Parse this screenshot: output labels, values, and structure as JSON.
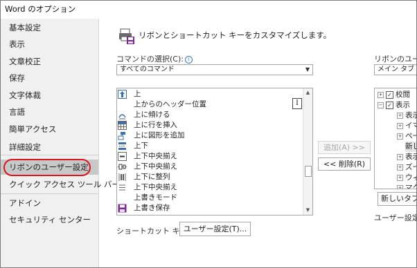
{
  "window": {
    "title": "Word のオプション"
  },
  "nav": {
    "items": [
      {
        "label": "基本設定"
      },
      {
        "label": "表示"
      },
      {
        "label": "文章校正"
      },
      {
        "label": "保存"
      },
      {
        "label": "文字体裁"
      },
      {
        "label": "言語"
      },
      {
        "label": "簡単アクセス"
      },
      {
        "label": "詳細設定"
      },
      {
        "label": "リボンのユーザー設定"
      },
      {
        "label": "クイック アクセス ツール バー"
      },
      {
        "label": "アドイン"
      },
      {
        "label": "セキュリティ センター"
      }
    ],
    "selected_index": 8,
    "highlight_color": "#d8141c"
  },
  "main": {
    "header": "リボンとショートカット キーをカスタマイズします。",
    "command_select_label": "コマンドの選択(C):",
    "command_select_value": "すべてのコマンド",
    "ribbon_label": "リボンのユーザ",
    "ribbon_value": "メイン タブ",
    "commands": [
      {
        "label": "上",
        "icon": "arrow-up-icon"
      },
      {
        "label": "上からのヘッダー位置",
        "icon": "none"
      },
      {
        "label": "上に傾ける",
        "icon": "tilt-up-icon"
      },
      {
        "label": "上に行を挿入",
        "icon": "insert-row-above-icon"
      },
      {
        "label": "上に図形を追加",
        "icon": "add-shape-above-icon"
      },
      {
        "label": "上下",
        "icon": "top-bottom-icon"
      },
      {
        "label": "上下中央揃え",
        "icon": "align-middle-icon"
      },
      {
        "label": "上下中央揃え",
        "icon": "align-middle-v-icon"
      },
      {
        "label": "上下に整列",
        "icon": "distribute-vertical-icon"
      },
      {
        "label": "上下中央揃え",
        "icon": "none"
      },
      {
        "label": "上書きモード",
        "icon": "none"
      },
      {
        "label": "上書き保存",
        "icon": "save-icon"
      }
    ],
    "add_button": "追加(A) >>",
    "remove_button": "<< 削除(R)",
    "tree": [
      {
        "label": "校閲",
        "level": 0,
        "expander": "⊞",
        "checked": true
      },
      {
        "label": "表示",
        "level": 0,
        "expander": "⊟",
        "checked": true
      },
      {
        "label": "表示",
        "level": 1,
        "expander": "⊞"
      },
      {
        "label": "イマ",
        "level": 1,
        "expander": "⊞"
      },
      {
        "label": "ペー",
        "level": 1,
        "expander": "⊞"
      },
      {
        "label": "新し",
        "level": 1,
        "expander": ""
      },
      {
        "label": "表示",
        "level": 1,
        "expander": "⊞"
      },
      {
        "label": "ズー",
        "level": 1,
        "expander": "⊞"
      },
      {
        "label": "ウィ",
        "level": 1,
        "expander": "⊞"
      },
      {
        "label": "マク",
        "level": 1,
        "expander": "⊞"
      }
    ],
    "new_tab_button": "新しいタブ(W",
    "user_settings_label": "ユーザー設定",
    "shortcut_label": "ショートカット キー:",
    "shortcut_button": "ユーザー設定(T)..."
  }
}
